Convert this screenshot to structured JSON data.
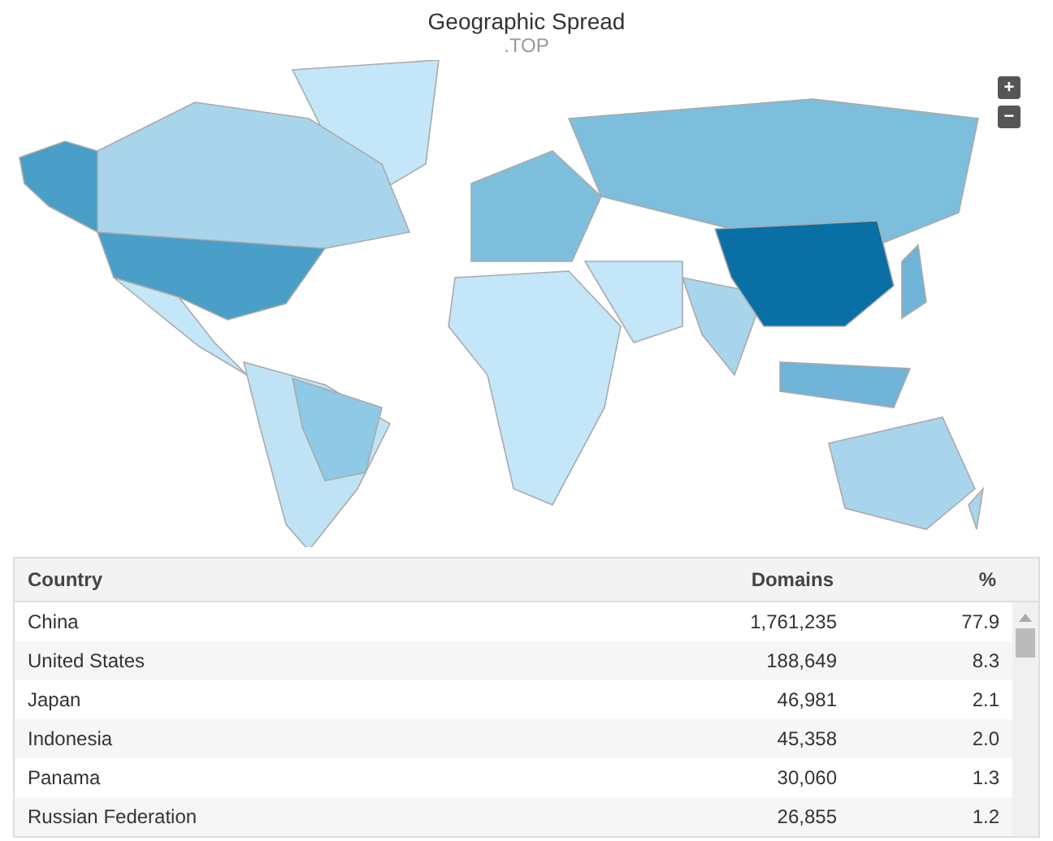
{
  "title": "Geographic Spread",
  "subtitle": ".TOP",
  "zoom_controls": [
    "+",
    "−"
  ],
  "table": {
    "columns": [
      "Country",
      "Domains",
      "%"
    ],
    "rows": [
      {
        "country": "China",
        "domains": "1,761,235",
        "percent": "77.9"
      },
      {
        "country": "United States",
        "domains": "188,649",
        "percent": "8.3"
      },
      {
        "country": "Japan",
        "domains": "46,981",
        "percent": "2.1"
      },
      {
        "country": "Indonesia",
        "domains": "45,358",
        "percent": "2.0"
      },
      {
        "country": "Panama",
        "domains": "30,060",
        "percent": "1.3"
      },
      {
        "country": "Russian Federation",
        "domains": "26,855",
        "percent": "1.2"
      }
    ]
  }
}
